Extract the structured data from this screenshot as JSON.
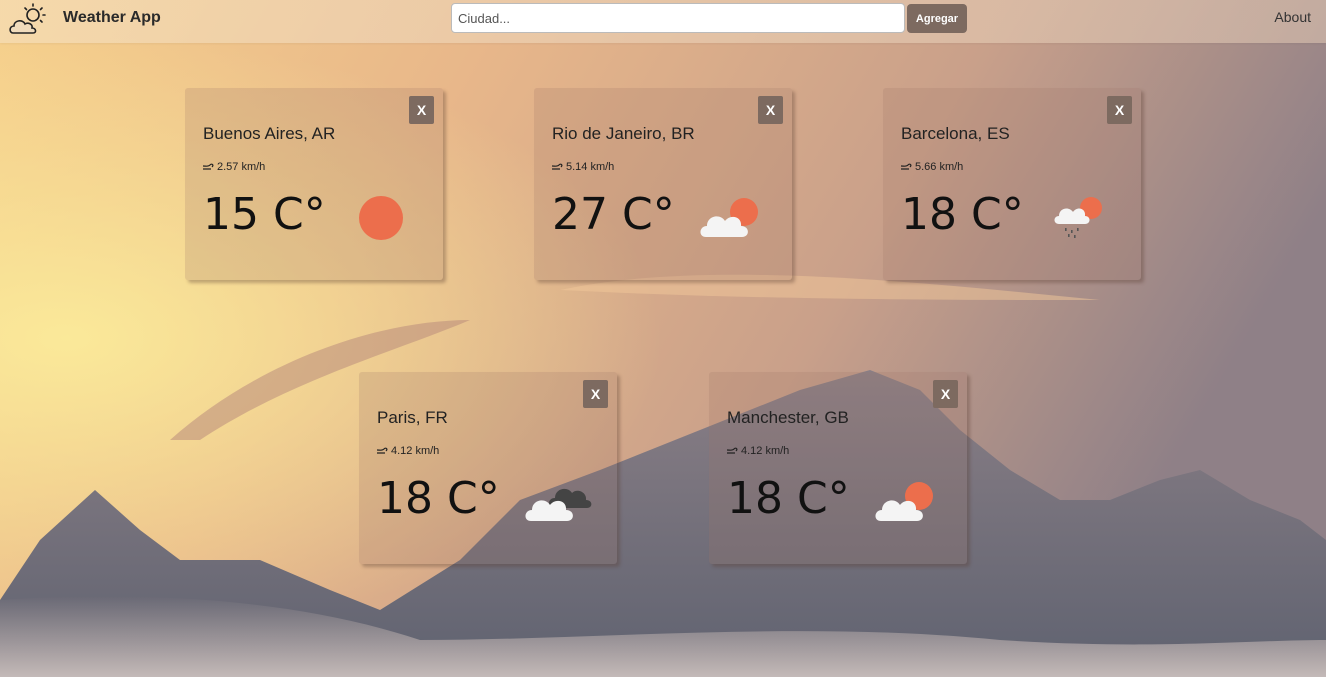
{
  "header": {
    "app_title": "Weather App",
    "logo_icon": "sun-cloud-icon",
    "search_placeholder": "Ciudad...",
    "add_button": "Agregar",
    "about_link": "About"
  },
  "cards": [
    {
      "city": "Buenos Aires, AR",
      "wind": "2.57 km/h",
      "temp": "15 C°",
      "icon": "sun-icon",
      "close": "X"
    },
    {
      "city": "Rio de Janeiro, BR",
      "wind": "5.14 km/h",
      "temp": "27 C°",
      "icon": "sun-behind-cloud-icon",
      "close": "X"
    },
    {
      "city": "Barcelona, ES",
      "wind": "5.66 km/h",
      "temp": "18 C°",
      "icon": "sun-cloud-rain-icon",
      "close": "X"
    },
    {
      "city": "Paris, FR",
      "wind": "4.12 km/h",
      "temp": "18 C°",
      "icon": "broken-clouds-icon",
      "close": "X"
    },
    {
      "city": "Manchester, GB",
      "wind": "4.12 km/h",
      "temp": "18 C°",
      "icon": "sun-behind-cloud-icon",
      "close": "X"
    }
  ],
  "colors": {
    "accent_button": "#7d6a60",
    "sun": "#ec6e4c",
    "cloud": "#f4f4f4",
    "dark_cloud": "#444444"
  }
}
